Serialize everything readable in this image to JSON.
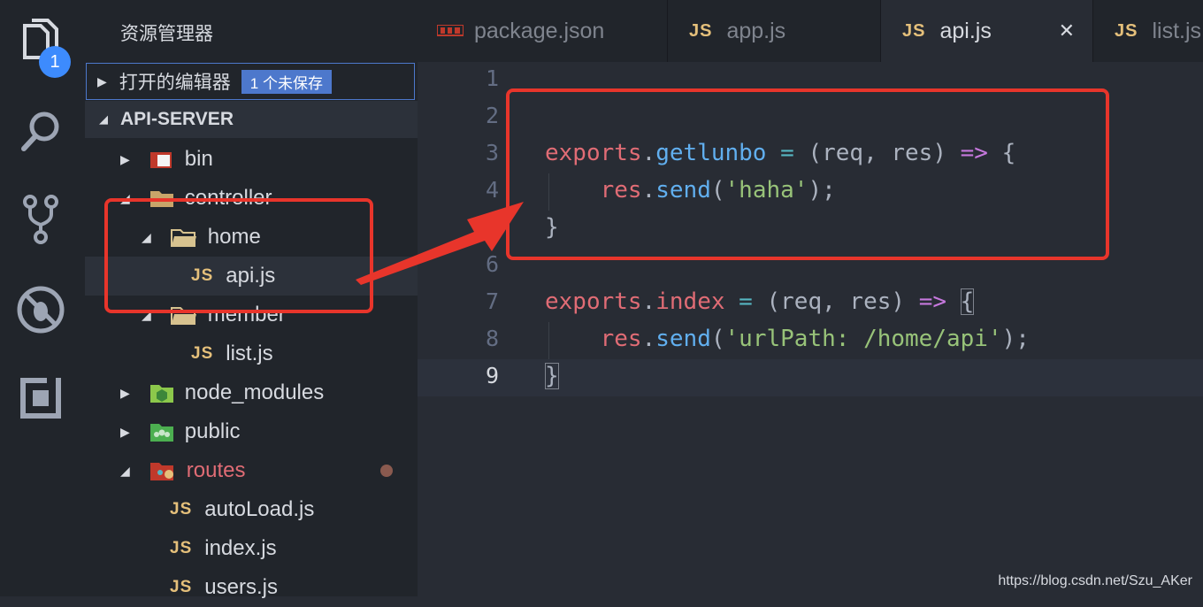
{
  "activity_bar": {
    "explorer_badge": "1",
    "icons": [
      "files-icon",
      "search-icon",
      "source-control-icon",
      "debug-icon",
      "extensions-icon"
    ]
  },
  "sidebar": {
    "title": "资源管理器",
    "open_editors": {
      "label": "打开的编辑器",
      "badge": "1 个未保存"
    },
    "project": "API-SERVER",
    "tree": [
      {
        "name": "bin",
        "type": "folder",
        "state": "collapsed"
      },
      {
        "name": "controller",
        "type": "folder",
        "state": "expanded"
      },
      {
        "name": "home",
        "type": "folder",
        "state": "expanded"
      },
      {
        "name": "api.js",
        "type": "js",
        "selected": true
      },
      {
        "name": "member",
        "type": "folder",
        "state": "expanded"
      },
      {
        "name": "list.js",
        "type": "js"
      },
      {
        "name": "node_modules",
        "type": "folder",
        "state": "collapsed"
      },
      {
        "name": "public",
        "type": "folder",
        "state": "collapsed"
      },
      {
        "name": "routes",
        "type": "folder",
        "state": "expanded",
        "modified": true
      },
      {
        "name": "autoLoad.js",
        "type": "js"
      },
      {
        "name": "index.js",
        "type": "js"
      },
      {
        "name": "users.js",
        "type": "js"
      }
    ]
  },
  "tabs": [
    {
      "label": "package.json",
      "icon": "json",
      "active": false
    },
    {
      "label": "app.js",
      "icon": "JS",
      "active": false
    },
    {
      "label": "api.js",
      "icon": "JS",
      "active": true,
      "close": "✕"
    },
    {
      "label": "list.js",
      "icon": "JS",
      "active": false
    }
  ],
  "js_icon_text": "JS",
  "editor": {
    "line_numbers": [
      "1",
      "2",
      "3",
      "4",
      "5",
      "6",
      "7",
      "8",
      "9"
    ],
    "current_line": "9",
    "lines": [
      [],
      [],
      [
        [
          "exports",
          "red"
        ],
        [
          ".",
          "plain"
        ],
        [
          "getlunbo",
          "blue"
        ],
        [
          " = ",
          "cyan"
        ],
        [
          "(",
          "plain"
        ],
        [
          "req",
          "plain"
        ],
        [
          ", ",
          "plain"
        ],
        [
          "res",
          "plain"
        ],
        [
          ") ",
          "plain"
        ],
        [
          "=>",
          "purple"
        ],
        [
          " {",
          "plain"
        ]
      ],
      [
        [
          "    ",
          "plain"
        ],
        [
          "res",
          "red"
        ],
        [
          ".",
          "plain"
        ],
        [
          "send",
          "blue"
        ],
        [
          "(",
          "plain"
        ],
        [
          "'haha'",
          "green"
        ],
        [
          ");",
          "plain"
        ]
      ],
      [
        [
          "}",
          "plain"
        ]
      ],
      [],
      [
        [
          "exports",
          "red"
        ],
        [
          ".",
          "plain"
        ],
        [
          "index",
          "red"
        ],
        [
          " = ",
          "cyan"
        ],
        [
          "(",
          "plain"
        ],
        [
          "req",
          "plain"
        ],
        [
          ", ",
          "plain"
        ],
        [
          "res",
          "plain"
        ],
        [
          ") ",
          "plain"
        ],
        [
          "=>",
          "purple"
        ],
        [
          " ",
          "plain"
        ],
        [
          "{",
          "bracket"
        ]
      ],
      [
        [
          "    ",
          "plain"
        ],
        [
          "res",
          "red"
        ],
        [
          ".",
          "plain"
        ],
        [
          "send",
          "blue"
        ],
        [
          "(",
          "plain"
        ],
        [
          "'urlPath: /home/api'",
          "green"
        ],
        [
          ");",
          "plain"
        ]
      ],
      [
        [
          "}",
          "bracket"
        ]
      ]
    ]
  },
  "watermark": "https://blog.csdn.net/Szu_AKer",
  "colors": {
    "annotation": "#e8352b",
    "accent": "#4d78cc",
    "badge": "#3d8bfd"
  }
}
